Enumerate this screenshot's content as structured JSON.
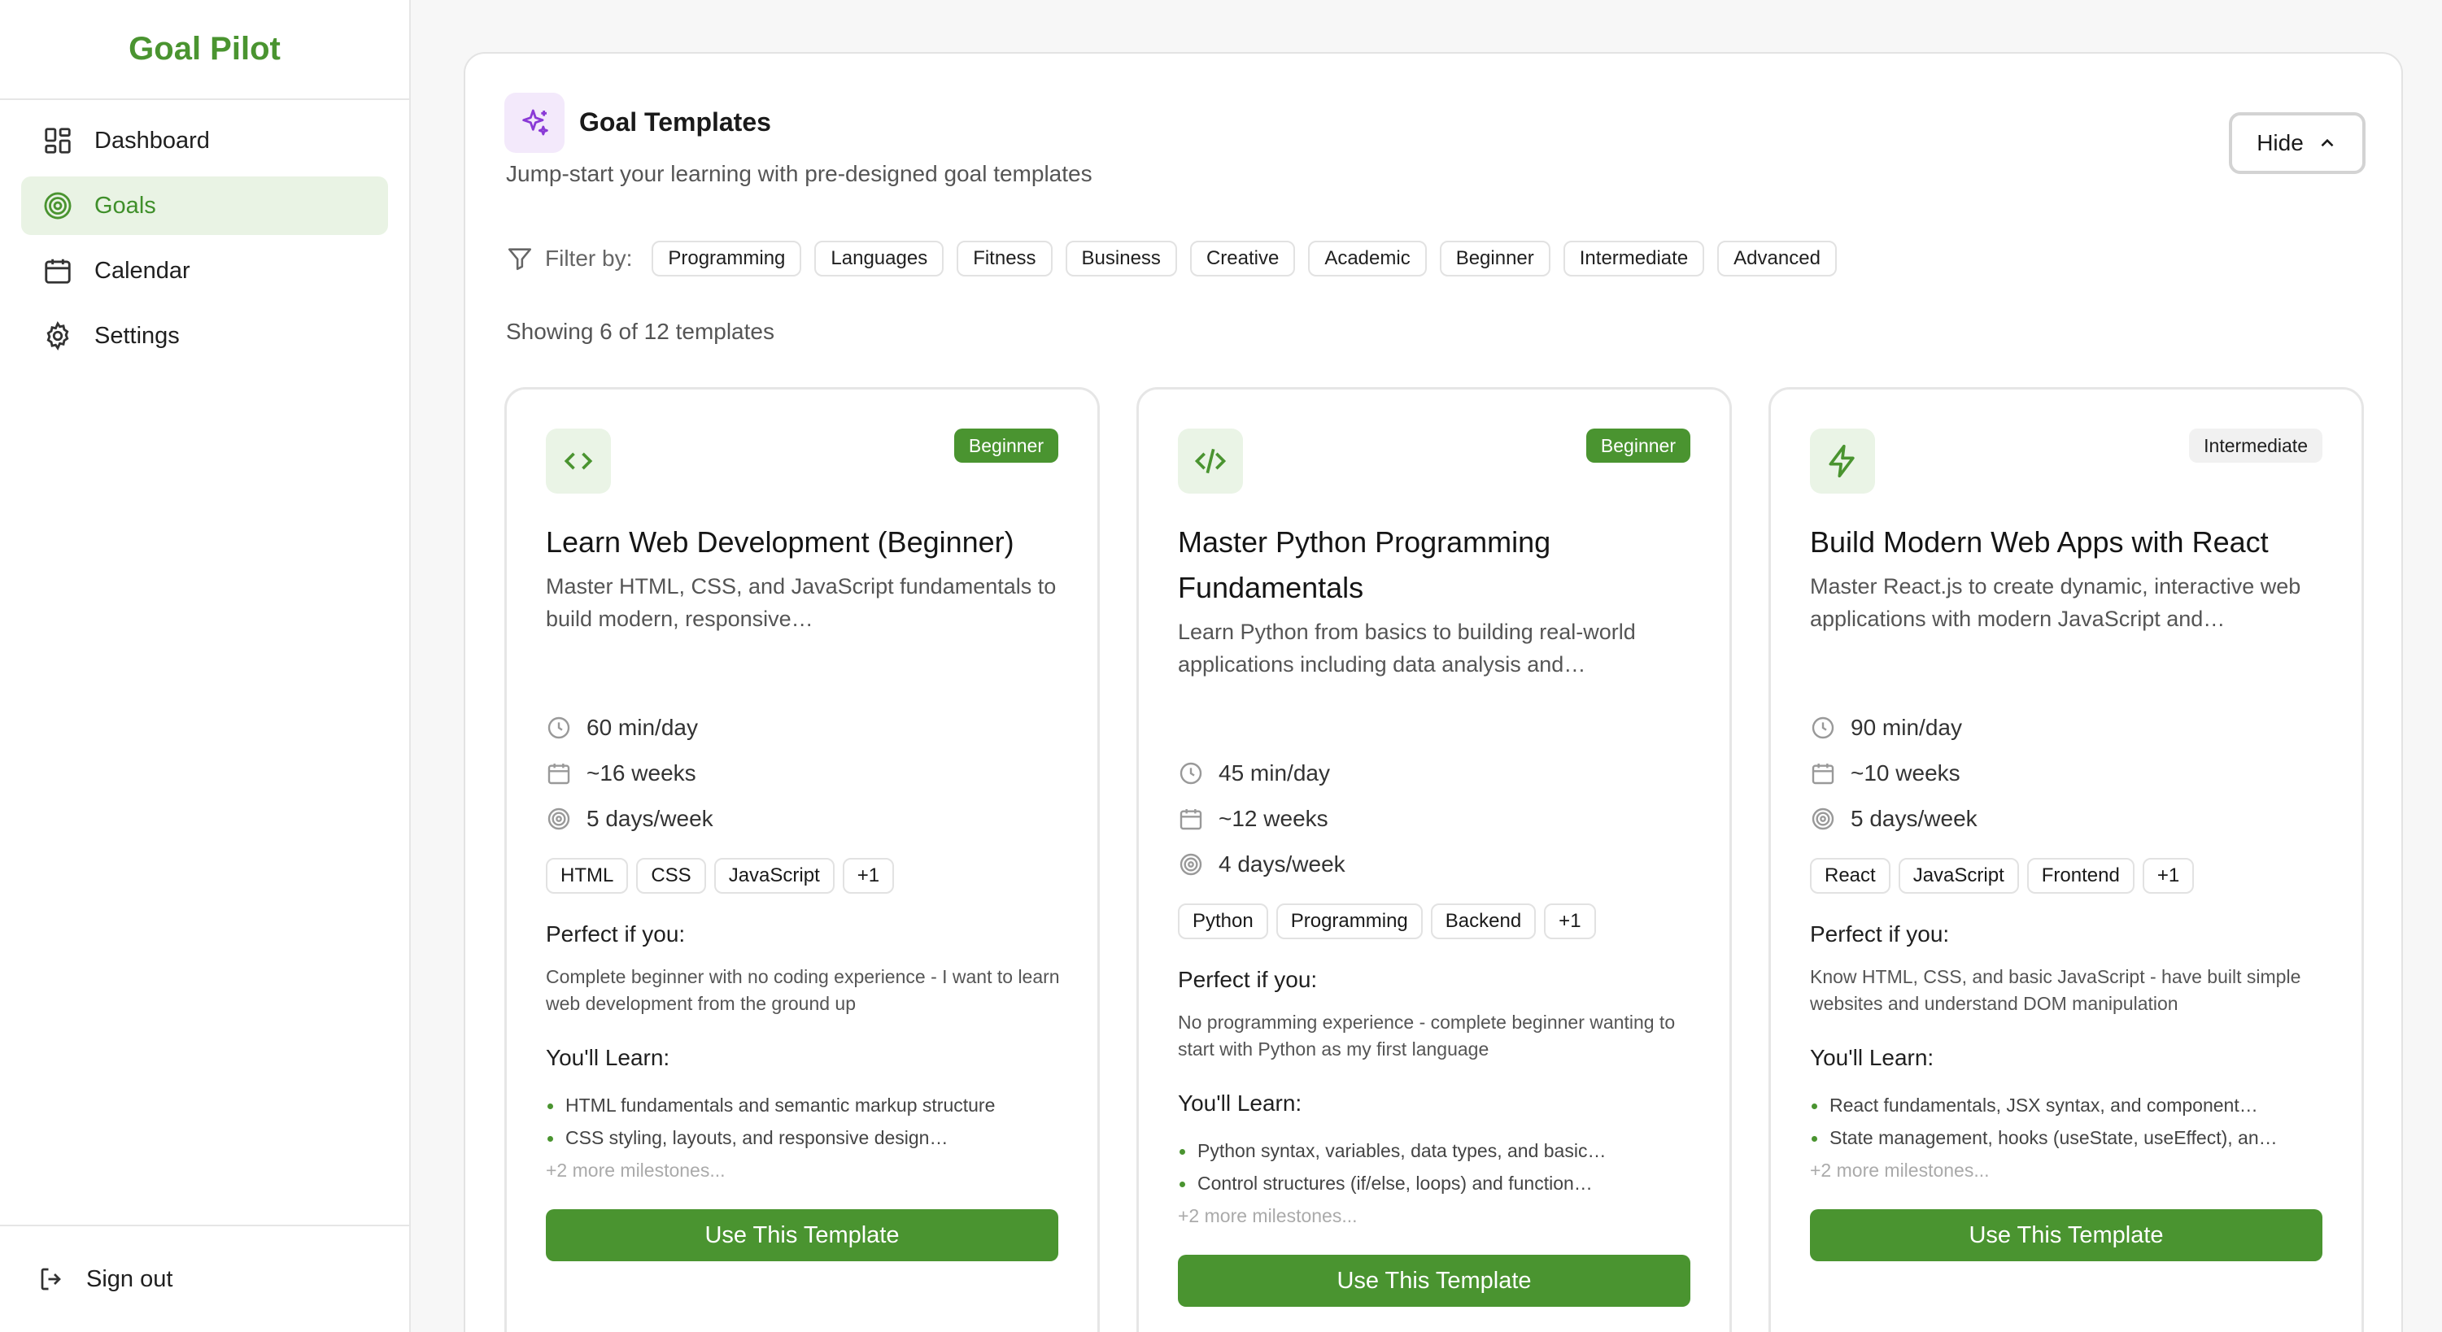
{
  "sidebar": {
    "brand": "Goal Pilot",
    "items": [
      {
        "label": "Dashboard"
      },
      {
        "label": "Goals"
      },
      {
        "label": "Calendar"
      },
      {
        "label": "Settings"
      }
    ],
    "signout": "Sign out"
  },
  "templates": {
    "title": "Goal Templates",
    "subtitle": "Jump-start your learning with pre-designed goal templates",
    "hide_label": "Hide",
    "filter_label": "Filter by:",
    "filters": [
      "Programming",
      "Languages",
      "Fitness",
      "Business",
      "Creative",
      "Academic",
      "Beginner",
      "Intermediate",
      "Advanced"
    ],
    "showing": "Showing 6 of 12 templates",
    "cards": [
      {
        "level": "Beginner",
        "title": "Learn Web Development (Beginner)",
        "desc": "Master HTML, CSS, and JavaScript fundamentals to build modern, responsive…",
        "time": "60 min/day",
        "duration": "~16 weeks",
        "days": "5 days/week",
        "tags": [
          "HTML",
          "CSS",
          "JavaScript",
          "+1"
        ],
        "perfect_title": "Perfect if you:",
        "perfect": "Complete beginner with no coding experience - I want to learn web development from the ground up",
        "learn_title": "You'll Learn:",
        "learn": [
          "HTML fundamentals and semantic markup structure",
          "CSS styling, layouts, and responsive design…"
        ],
        "more": "+2 more milestones...",
        "button": "Use This Template"
      },
      {
        "level": "Beginner",
        "title": "Master Python Programming Fundamentals",
        "desc": "Learn Python from basics to building real-world applications including data analysis and…",
        "time": "45 min/day",
        "duration": "~12 weeks",
        "days": "4 days/week",
        "tags": [
          "Python",
          "Programming",
          "Backend",
          "+1"
        ],
        "perfect_title": "Perfect if you:",
        "perfect": "No programming experience - complete beginner wanting to start with Python as my first language",
        "learn_title": "You'll Learn:",
        "learn": [
          "Python syntax, variables, data types, and basic…",
          "Control structures (if/else, loops) and function…"
        ],
        "more": "+2 more milestones...",
        "button": "Use This Template"
      },
      {
        "level": "Intermediate",
        "title": "Build Modern Web Apps with React",
        "desc": "Master React.js to create dynamic, interactive web applications with modern JavaScript and…",
        "time": "90 min/day",
        "duration": "~10 weeks",
        "days": "5 days/week",
        "tags": [
          "React",
          "JavaScript",
          "Frontend",
          "+1"
        ],
        "perfect_title": "Perfect if you:",
        "perfect": "Know HTML, CSS, and basic JavaScript - have built simple websites and understand DOM manipulation",
        "learn_title": "You'll Learn:",
        "learn": [
          "React fundamentals, JSX syntax, and component…",
          "State management, hooks (useState, useEffect), an…"
        ],
        "more": "+2 more milestones...",
        "button": "Use This Template"
      }
    ]
  },
  "colors": {
    "brand_green": "#4a9430",
    "active_bg": "#e9f3e4",
    "accent_purple": "#8a3ad6"
  }
}
